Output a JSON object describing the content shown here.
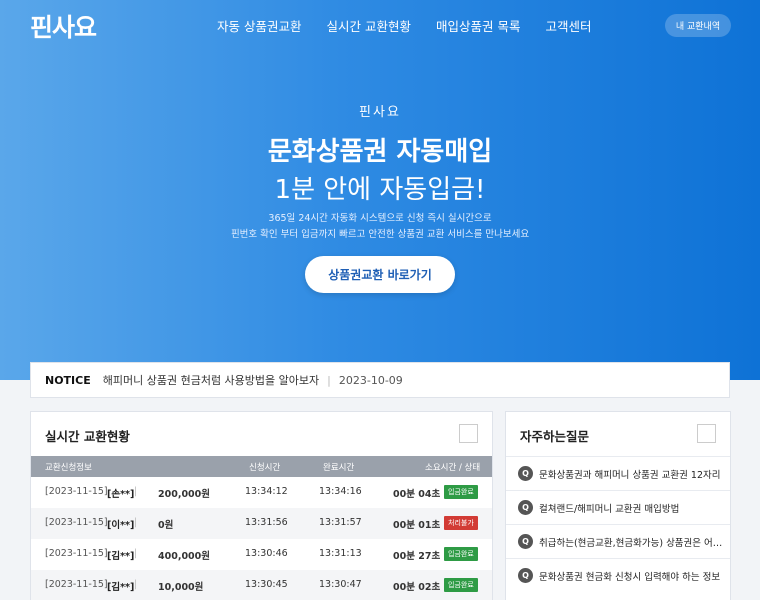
{
  "brand": {
    "logo": "핀사요"
  },
  "nav": {
    "items": [
      "자동 상품권교환",
      "실시간 교환현황",
      "매입상품권 목록",
      "고객센터"
    ],
    "my_button": "내 교환내역"
  },
  "hero": {
    "subtitle": "핀사요",
    "title_line1": "문화상품권 자동매입",
    "title_line2": "1분 안에 자동입금!",
    "desc_line1": "365일 24시간 자동화 시스템으로 신청 즉시 실시간으로",
    "desc_line2": "핀번호 확인 부터 입금까지 빠르고 안전한 상품권 교환 서비스를 만나보세요",
    "cta": "상품권교환 바로가기",
    "gradient_from": "#5aa7ea",
    "gradient_to": "#0e72d6"
  },
  "notice": {
    "tag": "NOTICE",
    "title": "해피머니 상품권 현금처럼 사용방법을 알아보자",
    "date": "2023-10-09"
  },
  "live": {
    "title": "실시간 교환현황",
    "headers": {
      "info": "교환신청정보",
      "req": "신청시간",
      "done": "완료시간",
      "status": "소요시간 / 상태"
    },
    "rows": [
      {
        "date": "[2023-11-15]",
        "name": "[손**]",
        "sep": "|",
        "amount": "200,000원",
        "req": "13:34:12",
        "done": "13:34:16",
        "dur": "00분 04초",
        "status": "입금완료"
      },
      {
        "date": "[2023-11-15]",
        "name": "[이**]",
        "sep": "|",
        "amount": "0원",
        "req": "13:31:56",
        "done": "13:31:57",
        "dur": "00분 01초",
        "status": "처리불가"
      },
      {
        "date": "[2023-11-15]",
        "name": "[김**]",
        "sep": "|",
        "amount": "400,000원",
        "req": "13:30:46",
        "done": "13:31:13",
        "dur": "00분 27초",
        "status": "입금완료"
      },
      {
        "date": "[2023-11-15]",
        "name": "[김**]",
        "sep": "|",
        "amount": "10,000원",
        "req": "13:30:45",
        "done": "13:30:47",
        "dur": "00분 02초",
        "status": "입금완료"
      }
    ],
    "status_colors": {
      "ok": "#2e9b45",
      "fail": "#d23b35"
    }
  },
  "faq": {
    "title": "자주하는질문",
    "q_mark": "Q",
    "items": [
      "문화상품권과 해피머니 상품권 교환권 12자리",
      "컬쳐랜드/해피머니 교환권 매입방법",
      "취급하는(현금교환,현금화가능) 상품권은 어떤 것이 있나요",
      "문화상품권 현금화 신청시 입력해야 하는 정보"
    ]
  }
}
